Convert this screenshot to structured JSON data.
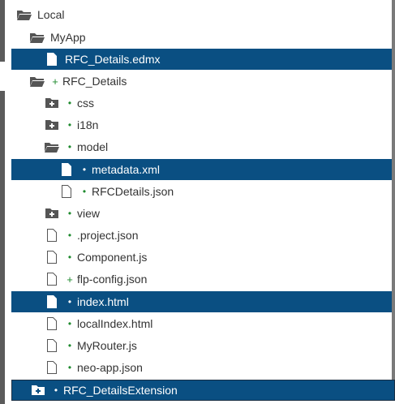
{
  "tree": {
    "items": [
      {
        "label": "Local",
        "icon": "folder-open-icon",
        "status": ""
      },
      {
        "label": "MyApp",
        "icon": "folder-open-icon",
        "status": ""
      },
      {
        "label": "RFC_Details.edmx",
        "icon": "file-icon",
        "status": "",
        "selected": true
      },
      {
        "label": "RFC_Details",
        "icon": "folder-open-icon",
        "status": "+"
      },
      {
        "label": "css",
        "icon": "folder-collapsed-icon",
        "status": "•"
      },
      {
        "label": "i18n",
        "icon": "folder-collapsed-icon",
        "status": "•"
      },
      {
        "label": "model",
        "icon": "folder-open-icon",
        "status": "•"
      },
      {
        "label": "metadata.xml",
        "icon": "file-icon",
        "status": "•",
        "selected": true
      },
      {
        "label": "RFCDetails.json",
        "icon": "file-outline-icon",
        "status": "•"
      },
      {
        "label": "view",
        "icon": "folder-collapsed-icon",
        "status": "•"
      },
      {
        "label": ".project.json",
        "icon": "file-outline-icon",
        "status": "•"
      },
      {
        "label": "Component.js",
        "icon": "file-outline-icon",
        "status": "•"
      },
      {
        "label": "flp-config.json",
        "icon": "file-outline-icon",
        "status": "+"
      },
      {
        "label": "index.html",
        "icon": "file-icon",
        "status": "•",
        "selected": true
      },
      {
        "label": "localIndex.html",
        "icon": "file-outline-icon",
        "status": "•"
      },
      {
        "label": "MyRouter.js",
        "icon": "file-outline-icon",
        "status": "•"
      },
      {
        "label": "neo-app.json",
        "icon": "file-outline-icon",
        "status": "•"
      },
      {
        "label": "RFC_DetailsExtension",
        "icon": "folder-collapsed-icon",
        "status": "•",
        "selected": true
      }
    ]
  },
  "colors": {
    "selection": "#0a4f82",
    "status_green": "#1e8a2e",
    "icon_gray": "#555555"
  }
}
